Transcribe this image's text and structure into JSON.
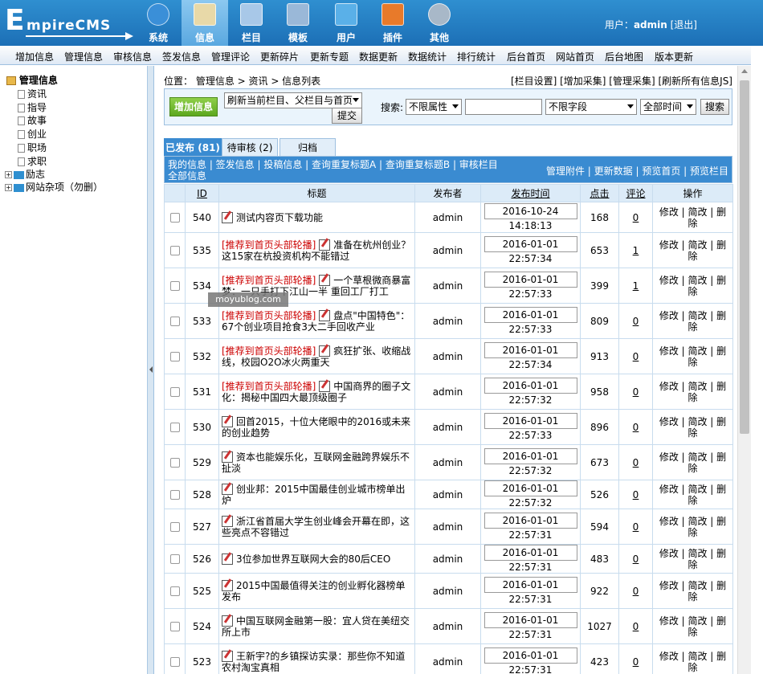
{
  "logo": {
    "letter": "E",
    "rest": "mpireCMS"
  },
  "topnav": [
    {
      "label": "系统",
      "icon": "globe-icon"
    },
    {
      "label": "信息",
      "icon": "edit-document-icon"
    },
    {
      "label": "栏目",
      "icon": "folder-icon"
    },
    {
      "label": "模板",
      "icon": "template-window-icon"
    },
    {
      "label": "用户",
      "icon": "user-icon"
    },
    {
      "label": "插件",
      "icon": "tools-icon"
    },
    {
      "label": "其他",
      "icon": "gear-icon"
    }
  ],
  "user": {
    "prefix": "用户：",
    "name": "admin",
    "logout": "[退出]"
  },
  "menubar": [
    "增加信息",
    "管理信息",
    "审核信息",
    "签发信息",
    "管理评论",
    "更新碎片",
    "更新专题",
    "数据更新",
    "数据统计",
    "排行统计",
    "后台首页",
    "网站首页",
    "后台地图",
    "版本更新"
  ],
  "sidebar": {
    "root": "管理信息",
    "children": [
      "资讯",
      "指导",
      "故事",
      "创业",
      "职场",
      "求职"
    ],
    "groups": [
      "励志",
      "网站杂项（勿删）"
    ]
  },
  "breadcrumb": "位置： 管理信息 > 资讯 > 信息列表",
  "toplinks": "[栏目设置] [增加采集] [管理采集] [刷新所有信息JS]",
  "toolbar": {
    "add_button": "增加信息",
    "refresh_select": "刷新当前栏目、父栏目与首页",
    "submit": "提交",
    "search_label": "搜索:",
    "attr_select": "不限属性",
    "search_value": "",
    "field_select": "不限字段",
    "time_select": "全部时间",
    "search_button": "搜索"
  },
  "tabs": [
    "已发布 (81)",
    "待审核 (2)",
    "归档"
  ],
  "listhead": {
    "left": "我的信息 | 签发信息 | 投稿信息 | 查询重复标题A | 查询重复标题B | 审核栏目全部信息",
    "right": "管理附件 | 更新数据 | 预览首页 | 预览栏目"
  },
  "columns": [
    "ID",
    "标题",
    "发布者",
    "发布时间",
    "点击",
    "评论",
    "操作"
  ],
  "rows": [
    {
      "id": "540",
      "tag": "",
      "title": "测试内容页下载功能",
      "author": "admin",
      "time": "2016-10-24 14:18:13",
      "hits": "168",
      "comments": "0"
    },
    {
      "id": "535",
      "tag": "[推荐到首页头部轮播]",
      "title": "准备在杭州创业？这15家在杭投资机构不能错过",
      "author": "admin",
      "time": "2016-01-01 22:57:34",
      "hits": "653",
      "comments": "1"
    },
    {
      "id": "534",
      "tag": "[推荐到首页头部轮播]",
      "title": "一个草根微商暴富梦：一只手打下江山一半 重回工厂打工",
      "author": "admin",
      "time": "2016-01-01 22:57:33",
      "hits": "399",
      "comments": "1"
    },
    {
      "id": "533",
      "tag": "[推荐到首页头部轮播]",
      "title": "盘点\"中国特色\"：67个创业项目抢食3大二手回收产业",
      "author": "admin",
      "time": "2016-01-01 22:57:33",
      "hits": "809",
      "comments": "0"
    },
    {
      "id": "532",
      "tag": "[推荐到首页头部轮播]",
      "title": "疯狂扩张、收缩战线，校园O2O冰火两重天",
      "author": "admin",
      "time": "2016-01-01 22:57:34",
      "hits": "913",
      "comments": "0"
    },
    {
      "id": "531",
      "tag": "[推荐到首页头部轮播]",
      "title": "中国商界的圈子文化：揭秘中国四大最顶级圈子",
      "author": "admin",
      "time": "2016-01-01 22:57:32",
      "hits": "958",
      "comments": "0"
    },
    {
      "id": "530",
      "tag": "",
      "title": "回首2015，十位大佬眼中的2016或未来的创业趋势",
      "author": "admin",
      "time": "2016-01-01 22:57:33",
      "hits": "896",
      "comments": "0"
    },
    {
      "id": "529",
      "tag": "",
      "title": "资本也能娱乐化，互联网金融跨界娱乐不扯淡",
      "author": "admin",
      "time": "2016-01-01 22:57:32",
      "hits": "673",
      "comments": "0"
    },
    {
      "id": "528",
      "tag": "",
      "title": "创业邦：2015中国最佳创业城市榜单出炉",
      "author": "admin",
      "time": "2016-01-01 22:57:32",
      "hits": "526",
      "comments": "0"
    },
    {
      "id": "527",
      "tag": "",
      "title": "浙江省首届大学生创业峰会开幕在即，这些亮点不容错过",
      "author": "admin",
      "time": "2016-01-01 22:57:31",
      "hits": "594",
      "comments": "0"
    },
    {
      "id": "526",
      "tag": "",
      "title": "3位参加世界互联网大会的80后CEO",
      "author": "admin",
      "time": "2016-01-01 22:57:31",
      "hits": "483",
      "comments": "0"
    },
    {
      "id": "525",
      "tag": "",
      "title": "2015中国最值得关注的创业孵化器榜单发布",
      "author": "admin",
      "time": "2016-01-01 22:57:31",
      "hits": "922",
      "comments": "0"
    },
    {
      "id": "524",
      "tag": "",
      "title": "中国互联网金融第一股：宜人贷在美纽交所上市",
      "author": "admin",
      "time": "2016-01-01 22:57:31",
      "hits": "1027",
      "comments": "0"
    },
    {
      "id": "523",
      "tag": "",
      "title": "王新宇?的乡镇探访实录：那些你不知道农村淘宝真相",
      "author": "admin",
      "time": "2016-01-01 22:57:31",
      "hits": "423",
      "comments": "0"
    }
  ],
  "ops_text": "修改 | 简改 | 删除",
  "watermark": "moyublog.com"
}
